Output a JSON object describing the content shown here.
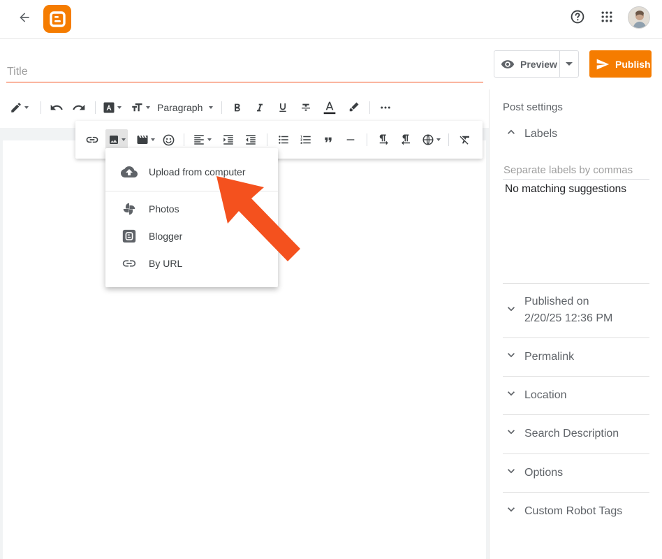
{
  "header": {
    "back_icon": "arrow-left-icon",
    "logo": "blogger-logo",
    "help_icon": "help-circle-icon",
    "apps_icon": "apps-grid-icon"
  },
  "editor": {
    "title_placeholder": "Title"
  },
  "actions": {
    "preview_label": "Preview",
    "publish_label": "Publish"
  },
  "toolbar": {
    "paragraph_label": "Paragraph"
  },
  "insert_image_menu": {
    "items": [
      {
        "label": "Upload from computer",
        "icon": "cloud-upload-icon"
      },
      {
        "label": "Photos",
        "icon": "photos-pinwheel-icon"
      },
      {
        "label": "Blogger",
        "icon": "blogger-icon"
      },
      {
        "label": "By URL",
        "icon": "link-icon"
      }
    ]
  },
  "sidebar": {
    "heading": "Post settings",
    "labels": {
      "title": "Labels",
      "input_placeholder": "Separate labels by commas",
      "suggestions_text": "No matching suggestions"
    },
    "published": {
      "title": "Published on",
      "date": "2/20/25 12:36 PM"
    },
    "sections": [
      {
        "label": "Permalink"
      },
      {
        "label": "Location"
      },
      {
        "label": "Search Description"
      },
      {
        "label": "Options"
      },
      {
        "label": "Custom Robot Tags"
      }
    ]
  },
  "colors": {
    "brand_orange": "#f57c00",
    "annotation_arrow": "#f4511e",
    "title_underline": "#f4511e"
  }
}
